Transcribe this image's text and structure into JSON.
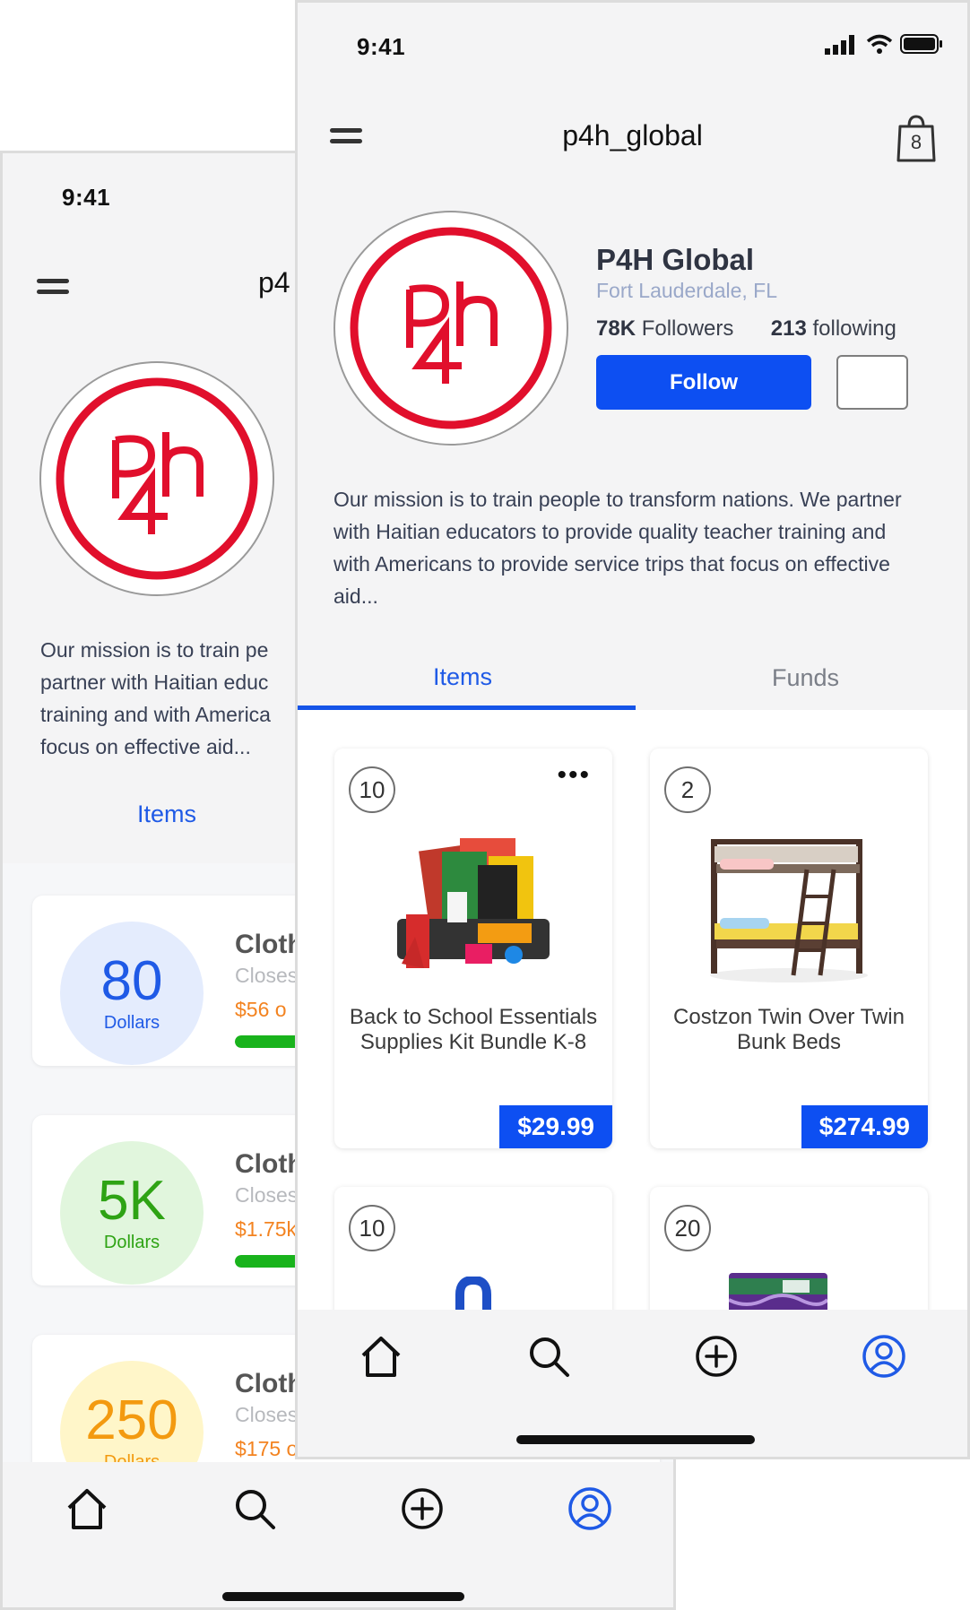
{
  "colors": {
    "accent": "#0d4ff2",
    "logo_red": "#e10f2c",
    "progress_green": "#19b31c",
    "amount_orange": "#f38320"
  },
  "status_bar": {
    "time": "9:41"
  },
  "header": {
    "handle": "p4h_global",
    "back_handle_visible": "p4",
    "cart_count": "8",
    "icons": [
      "menu-icon",
      "shopping-bag-icon"
    ]
  },
  "profile": {
    "name": "P4H Global",
    "location": "Fort Lauderdale, FL",
    "followers_count": "78K",
    "followers_label": "Followers",
    "following_count": "213",
    "following_label": "following",
    "follow_label": "Follow",
    "mission": "Our mission is to train people to transform nations. We partner with Haitian educators to provide quality teacher training and with Americans to provide service trips that focus on effective aid...",
    "mission_back_lines": [
      "Our mission is to train pe",
      "partner with Haitian educ",
      "training and with America",
      "focus on effective aid..."
    ]
  },
  "tabs": [
    {
      "label": "Items",
      "active": true
    },
    {
      "label": "Funds",
      "active": false
    }
  ],
  "items": [
    {
      "qty": "10",
      "name": "Back to School Essentials Supplies Kit Bundle K-8",
      "price": "$29.99",
      "has_menu": true
    },
    {
      "qty": "2",
      "name": "Costzon Twin Over Twin Bunk Beds",
      "price": "$274.99",
      "has_menu": false
    },
    {
      "qty": "10",
      "name": "",
      "price": ""
    },
    {
      "qty": "20",
      "name": "",
      "price": ""
    }
  ],
  "funds": [
    {
      "amount": "80",
      "unit": "Dollars",
      "title": "Cloth",
      "closes": "Closes",
      "raised": "$56 o",
      "progress": 0.7,
      "circle_bg": "#e4ecfd",
      "num_color": "#1f5ae6"
    },
    {
      "amount": "5K",
      "unit": "Dollars",
      "title": "Cloth",
      "closes": "Closes",
      "raised": "$1.75k",
      "progress": 0.35,
      "circle_bg": "#e1f6dd",
      "num_color": "#2ea314"
    },
    {
      "amount": "250",
      "unit": "Dollars",
      "title": "Cloth",
      "closes": "Closes",
      "raised": "$175 o",
      "progress": 0.7,
      "circle_bg": "#fff6c9",
      "num_color": "#f39a10"
    }
  ],
  "bottom_nav": [
    {
      "icon": "home-icon",
      "active": false
    },
    {
      "icon": "search-icon",
      "active": false
    },
    {
      "icon": "add-circle-icon",
      "active": false
    },
    {
      "icon": "profile-icon",
      "active": true
    }
  ]
}
